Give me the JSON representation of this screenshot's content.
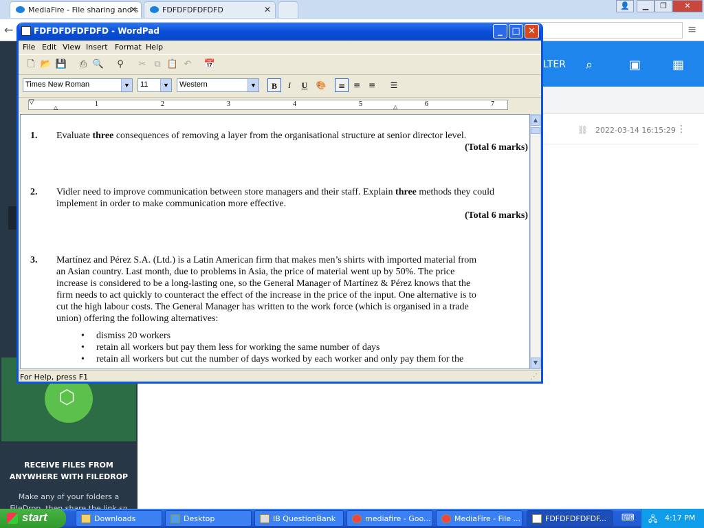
{
  "browser": {
    "tabs": [
      {
        "title": "MediaFire - File sharing and s",
        "active": true
      },
      {
        "title": "FDFDFDFDFDFD",
        "active": false
      }
    ]
  },
  "mediafire": {
    "header_filter_label": "LTER",
    "file_row": {
      "date": "2022-03-14 16:15:29"
    },
    "filedrop_title": "RECEIVE FILES FROM ANYWHERE WITH FILEDROP",
    "filedrop_subtitle": "Make any of your folders a FileDrop, then share the link so your friends"
  },
  "wordpad": {
    "title": "FDFDFDFDFDFD - WordPad",
    "menu": [
      "File",
      "Edit",
      "View",
      "Insert",
      "Format",
      "Help"
    ],
    "font_name": "Times New Roman",
    "font_size": "11",
    "script": "Western",
    "ruler_numbers": [
      "1",
      "2",
      "3",
      "4",
      "5",
      "6",
      "7"
    ],
    "status": "For Help, press F1",
    "document": {
      "q1": {
        "num": "1.",
        "pre": "Evaluate ",
        "bold": "three",
        "post": " consequences of removing a layer from the organisational structure at senior director level.",
        "marks": "(Total 6 marks)"
      },
      "q2": {
        "num": "2.",
        "pre": "Vidler need to improve communication between store managers and their staff. Explain ",
        "bold": "three",
        "post": " methods they could implement in order to make communication more effective.",
        "marks": "(Total 6 marks)"
      },
      "q3": {
        "num": "3.",
        "lines": [
          "Martínez and Pérez S.A. (Ltd.) is a Latin American firm that makes men’s shirts with imported material from",
          "an Asian country. Last month, due to problems in Asia, the price of material went up by 50%. The price",
          "increase is considered to be a long-lasting one, so the General Manager of Martínez & Pérez knows that the",
          "firm needs to act quickly to counteract the effect of the increase in the price of the input. One alternative is to",
          "cut the high labour costs. The General Manager has written to the work force (which is organised in a trade",
          "union) offering the following alternatives:"
        ],
        "bullets": [
          "dismiss 20 workers",
          "retain all workers but pay them less for working the same number of days",
          "retain all workers but cut the number of days worked by each worker and only pay them for the"
        ]
      }
    }
  },
  "taskbar": {
    "start_label": "start",
    "items": [
      "Downloads",
      "Desktop",
      "IB QuestionBank",
      "mediafire - Goo...",
      "MediaFire - File ...",
      "FDFDFDFDFDF..."
    ],
    "clock": "4:17 PM"
  }
}
